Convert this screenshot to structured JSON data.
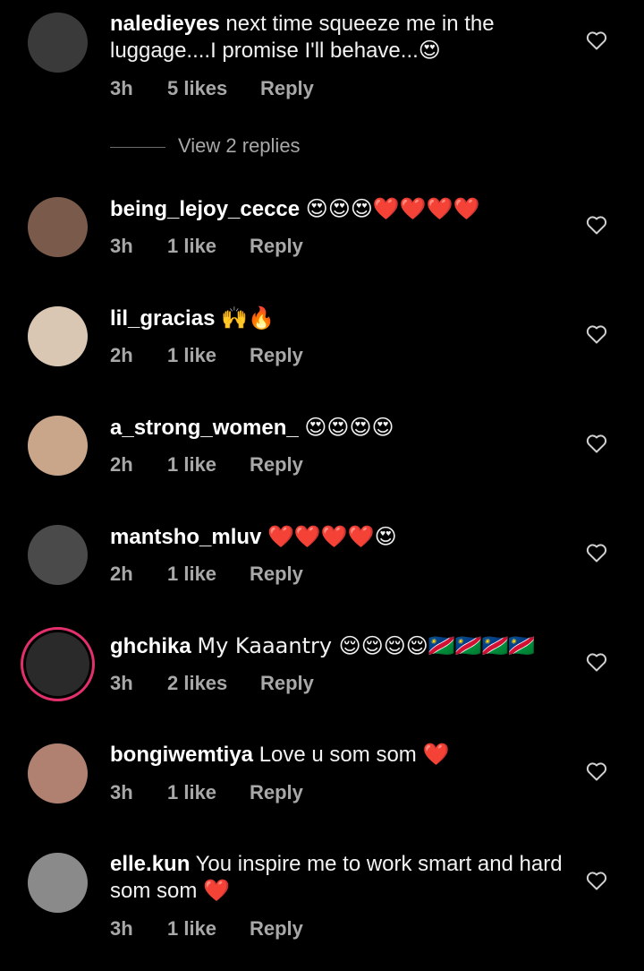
{
  "comments": [
    {
      "username": "naledieyes",
      "text": "next time squeeze me in the luggage....I promise I'll behave...😍",
      "time": "3h",
      "likes": "5 likes",
      "reply": "Reply",
      "avatar_color": "#3a3a3a"
    },
    {
      "username": "being_lejoy_cecce",
      "text": "😍😍😍❤️❤️❤️❤️",
      "time": "3h",
      "likes": "1 like",
      "reply": "Reply",
      "avatar_color": "#7a5a4a"
    },
    {
      "username": "lil_gracias",
      "text": "🙌🔥",
      "time": "2h",
      "likes": "1 like",
      "reply": "Reply",
      "avatar_color": "#d9c7b3"
    },
    {
      "username": "a_strong_women_",
      "text": "😍😍😍😍",
      "time": "2h",
      "likes": "1 like",
      "reply": "Reply",
      "avatar_color": "#c9a58a"
    },
    {
      "username": "mantsho_mluv",
      "text": "❤️❤️❤️❤️😍",
      "time": "2h",
      "likes": "1 like",
      "reply": "Reply",
      "avatar_color": "#4a4a4a"
    },
    {
      "username": "ghchika",
      "text": "My Kaaantry 😌😌😌😌🇳🇦🇳🇦🇳🇦🇳🇦",
      "time": "3h",
      "likes": "2 likes",
      "reply": "Reply",
      "avatar_color": "#2a2a2a"
    },
    {
      "username": "bongiwemtiya",
      "text": "Love u som som ❤️",
      "time": "3h",
      "likes": "1 like",
      "reply": "Reply",
      "avatar_color": "#b08070"
    },
    {
      "username": "elle.kun",
      "text": "You inspire me to work smart and hard som som ❤️",
      "time": "3h",
      "likes": "1 like",
      "reply": "Reply",
      "avatar_color": "#8a8a8a"
    }
  ],
  "view_replies": "View 2 replies",
  "icons": {
    "like": "heart-outline-icon"
  },
  "colors": {
    "background": "#000000",
    "secondary_text": "#a8a8a8",
    "story_ring": "#e1306c"
  }
}
